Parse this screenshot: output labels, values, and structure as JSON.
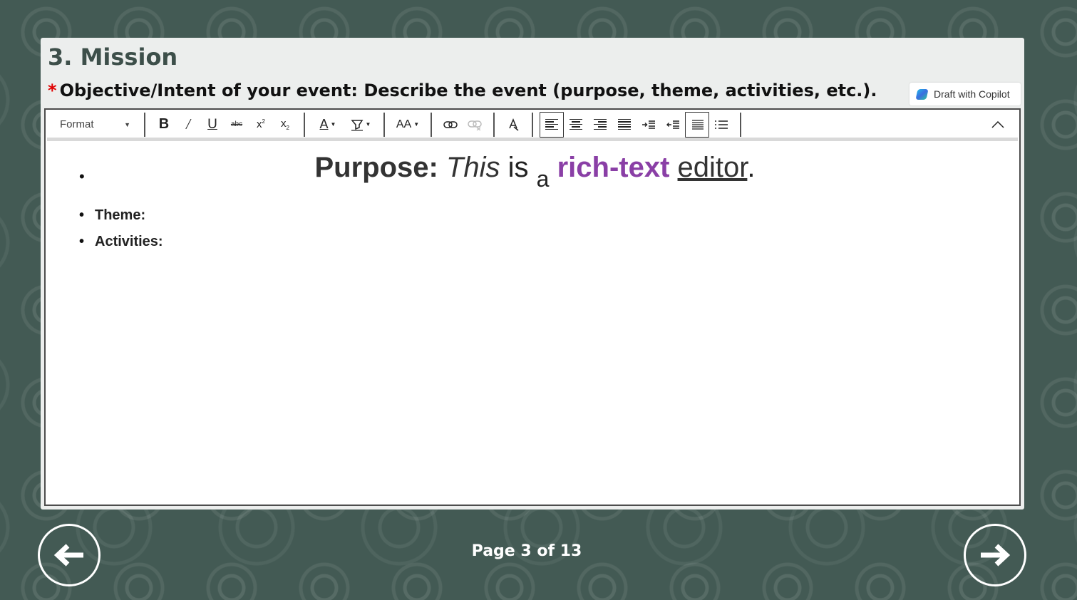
{
  "section": {
    "title": "3. Mission"
  },
  "question": {
    "required_marker": "*",
    "label": "Objective/Intent of your event:  Describe the event (purpose, theme, activities, etc.)."
  },
  "copilot": {
    "label": "Draft with Copilot"
  },
  "toolbar": {
    "format_label": "Format",
    "buttons": {
      "bold": "B",
      "italic": "/",
      "underline": "U",
      "strikethrough": "abc",
      "superscript": "x",
      "subscript": "x",
      "font_color": "A",
      "font_size": "AA"
    },
    "icons": [
      "bold-icon",
      "italic-icon",
      "underline-icon",
      "strikethrough-icon",
      "superscript-icon",
      "subscript-icon",
      "font-color-icon",
      "highlight-icon",
      "font-size-icon",
      "link-icon",
      "unlink-icon",
      "clear-format-icon",
      "align-left-icon",
      "align-center-icon",
      "align-right-icon",
      "justify-icon",
      "indent-icon",
      "outdent-icon",
      "bulleted-list-icon",
      "numbered-list-icon",
      "collapse-toolbar-icon"
    ],
    "active": [
      "align-left",
      "bulleted-list"
    ]
  },
  "content": {
    "purpose": {
      "label": "Purpose:",
      "word1": "This",
      "word2": "is",
      "word3": "a",
      "word4": "rich-text",
      "word5": "editor",
      "end": "."
    },
    "theme_label": "Theme:",
    "activities_label": "Activities:"
  },
  "footer": {
    "page_label": "Page 3 of 13",
    "prev_icon": "arrow-left-icon",
    "next_icon": "arrow-right-icon"
  },
  "colors": {
    "background": "#435a54",
    "card": "#eceeed",
    "required": "#e00000",
    "accent_purple": "#8a3fa6",
    "title": "#3d4f4a"
  }
}
